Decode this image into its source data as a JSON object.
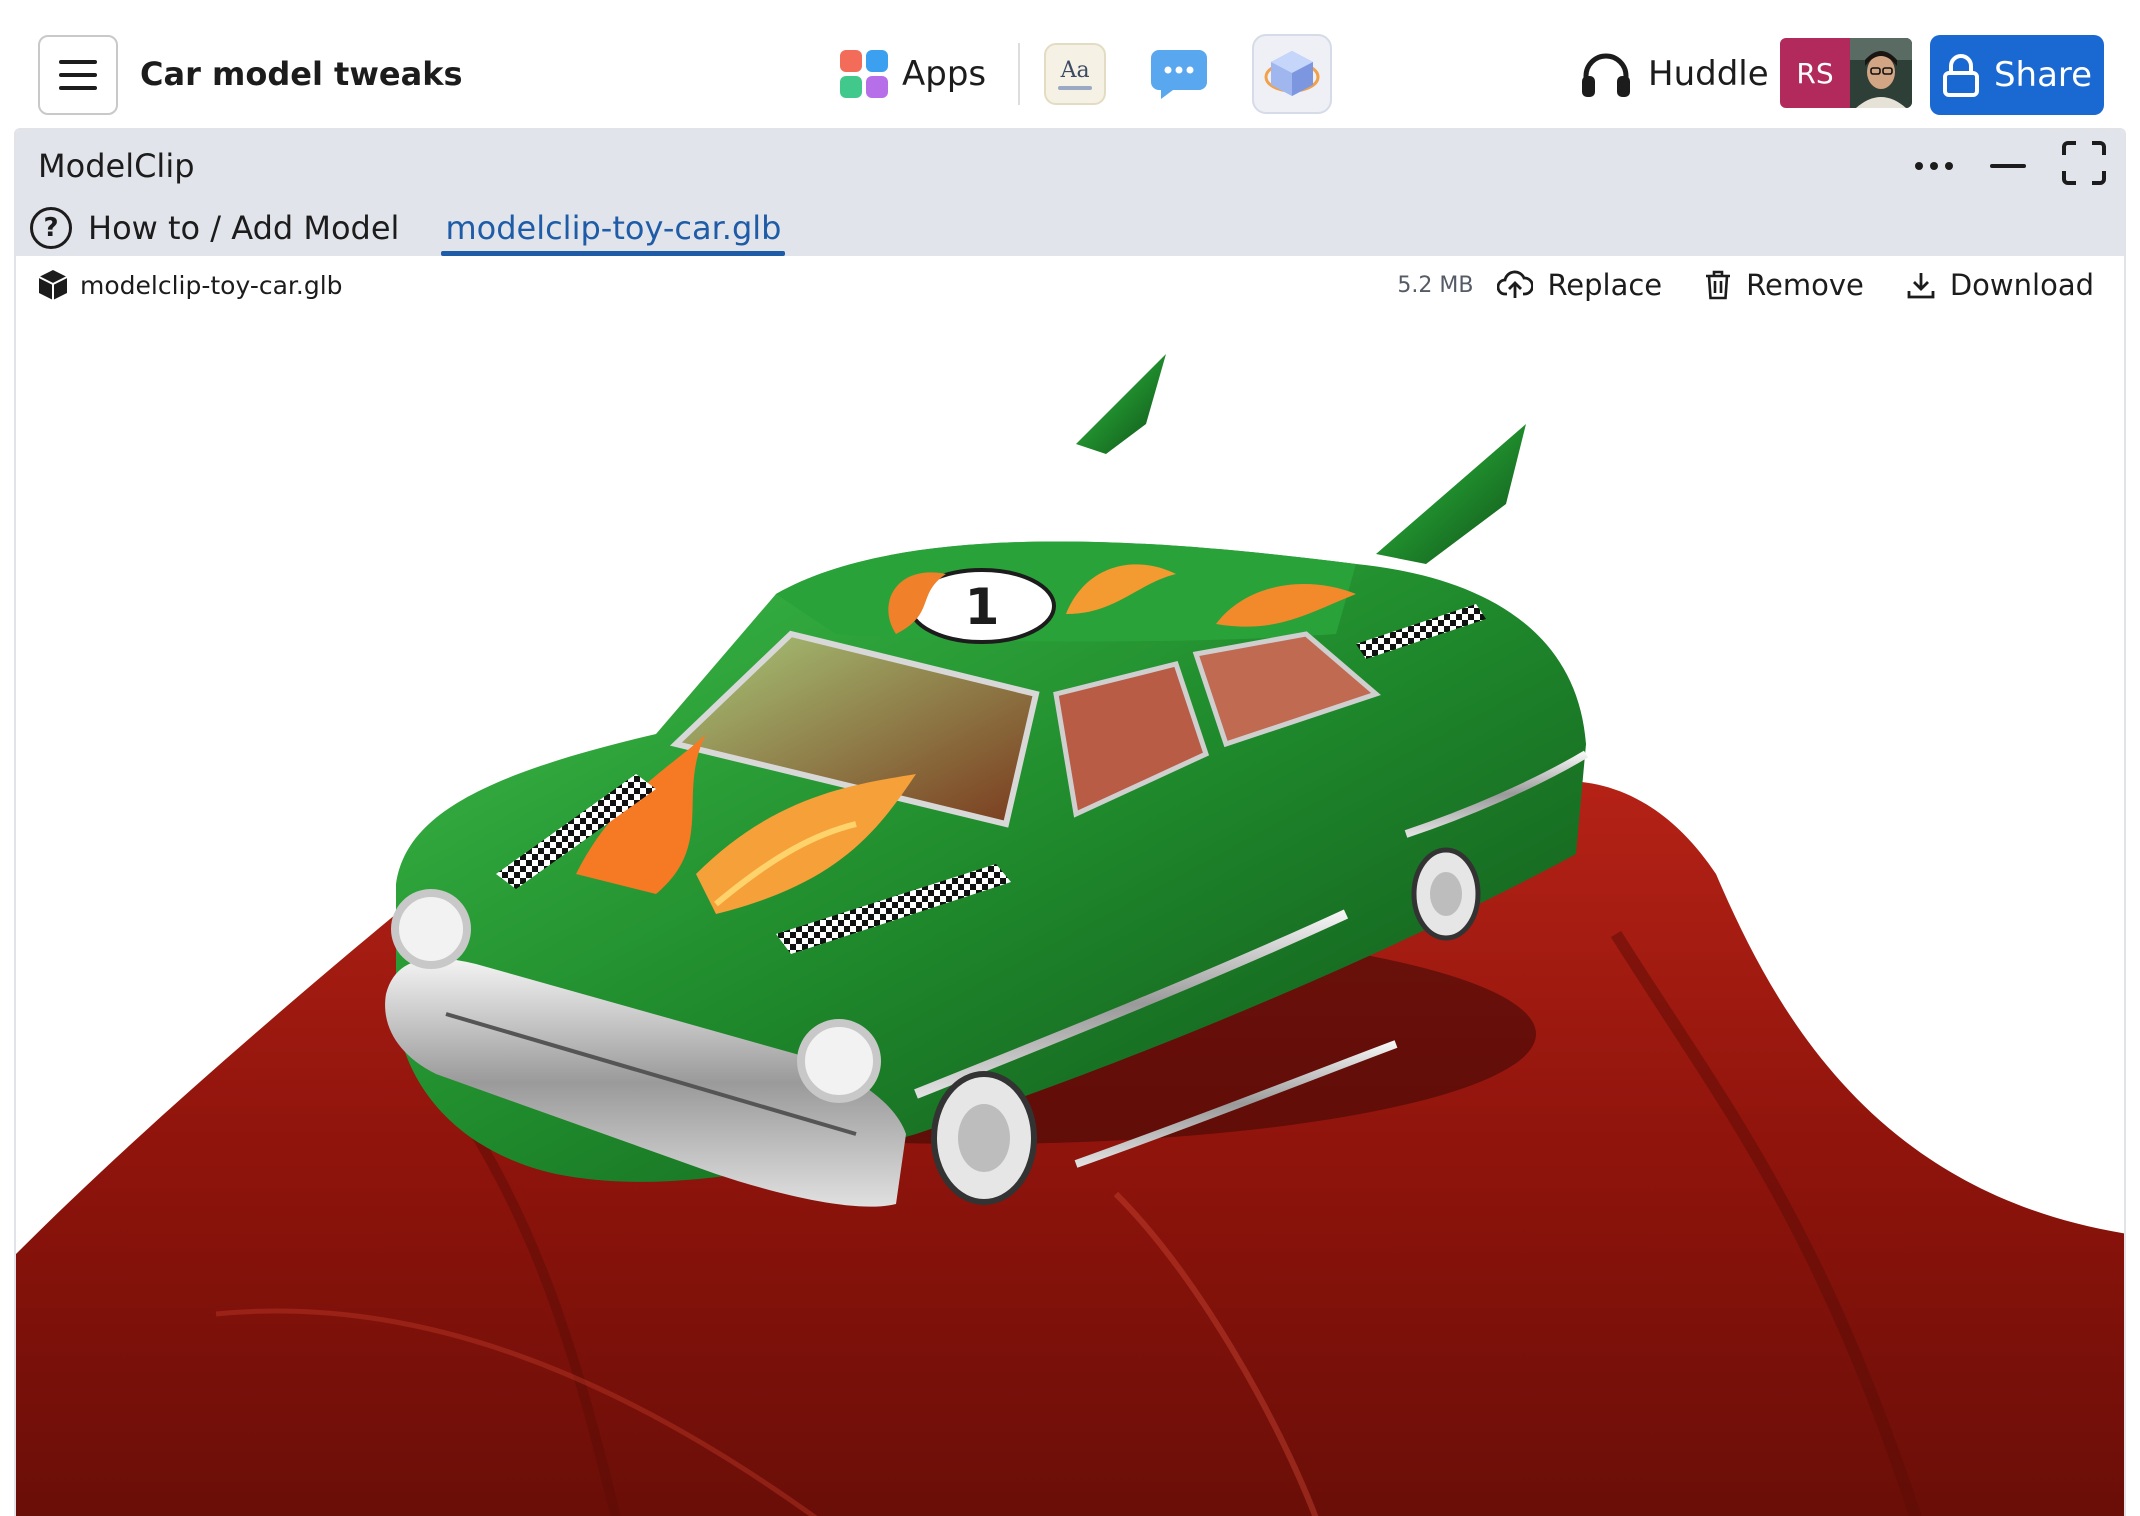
{
  "header": {
    "menu_icon": "hamburger-icon",
    "title": "Car model tweaks",
    "apps_label": "Apps",
    "apps_colors": [
      "#f36c5a",
      "#3aa0ef",
      "#41c98c",
      "#b76ee9"
    ],
    "tools": [
      {
        "name": "canvas-text-tool",
        "icon": "text-doc-icon",
        "glyph": "Aa"
      },
      {
        "name": "message-tool",
        "icon": "chat-bubble-icon"
      },
      {
        "name": "modelclip-tool",
        "icon": "3d-cube-icon"
      }
    ],
    "huddle_label": "Huddle",
    "avatar_initials": "RS",
    "avatar_color": "#b12a5b",
    "share_label": "Share",
    "share_color": "#1a68d1"
  },
  "panel": {
    "app_name": "ModelClip",
    "tabs": {
      "help_label": "How to / Add Model",
      "file_label": "modelclip-toy-car.glb"
    },
    "file": {
      "name": "modelclip-toy-car.glb",
      "size": "5.2 MB",
      "replace_label": "Replace",
      "remove_label": "Remove",
      "download_label": "Download"
    }
  },
  "viewer": {
    "subject": "green toy car with flame decals and number 1 on red velvet cloth",
    "roof_number": "1",
    "car_color": "#1f8a2c",
    "cloth_color": "#a3170f"
  }
}
